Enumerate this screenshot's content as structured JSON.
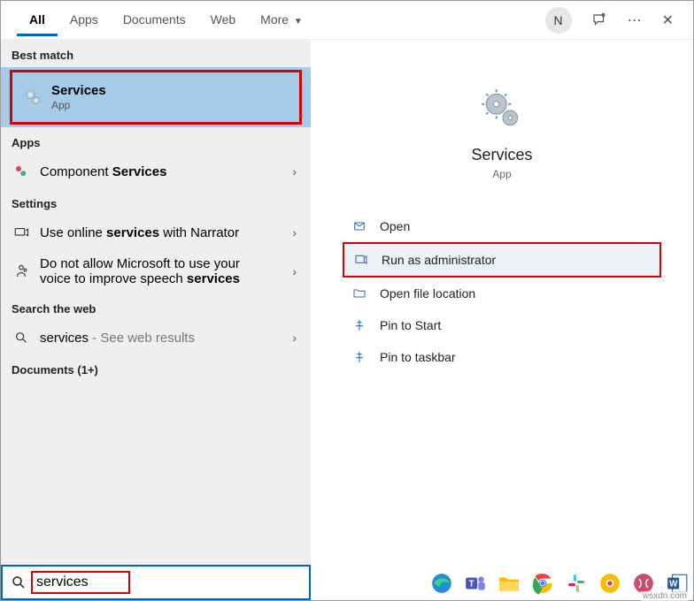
{
  "tabs": {
    "all": "All",
    "apps": "Apps",
    "documents": "Documents",
    "web": "Web",
    "more": "More"
  },
  "avatar_initial": "N",
  "sections": {
    "best_match": "Best match",
    "apps": "Apps",
    "settings": "Settings",
    "search_web": "Search the web",
    "documents": "Documents (1+)"
  },
  "best": {
    "title": "Services",
    "subtitle": "App"
  },
  "apps_results": {
    "component_services_pre": "Component ",
    "component_services_b": "Services"
  },
  "settings_results": {
    "narrator_pre": "Use online ",
    "narrator_b": "services",
    "narrator_post": " with Narrator",
    "speech_line1": "Do not allow Microsoft to use your",
    "speech_line2_pre": "voice to improve speech ",
    "speech_line2_b": "services"
  },
  "web_result": {
    "term": "services",
    "hint": " - See web results"
  },
  "preview": {
    "title": "Services",
    "subtitle": "App"
  },
  "actions": {
    "open": "Open",
    "run_admin": "Run as administrator",
    "open_loc": "Open file location",
    "pin_start": "Pin to Start",
    "pin_taskbar": "Pin to taskbar"
  },
  "search_value": "services",
  "watermark": "wsxdn.com"
}
